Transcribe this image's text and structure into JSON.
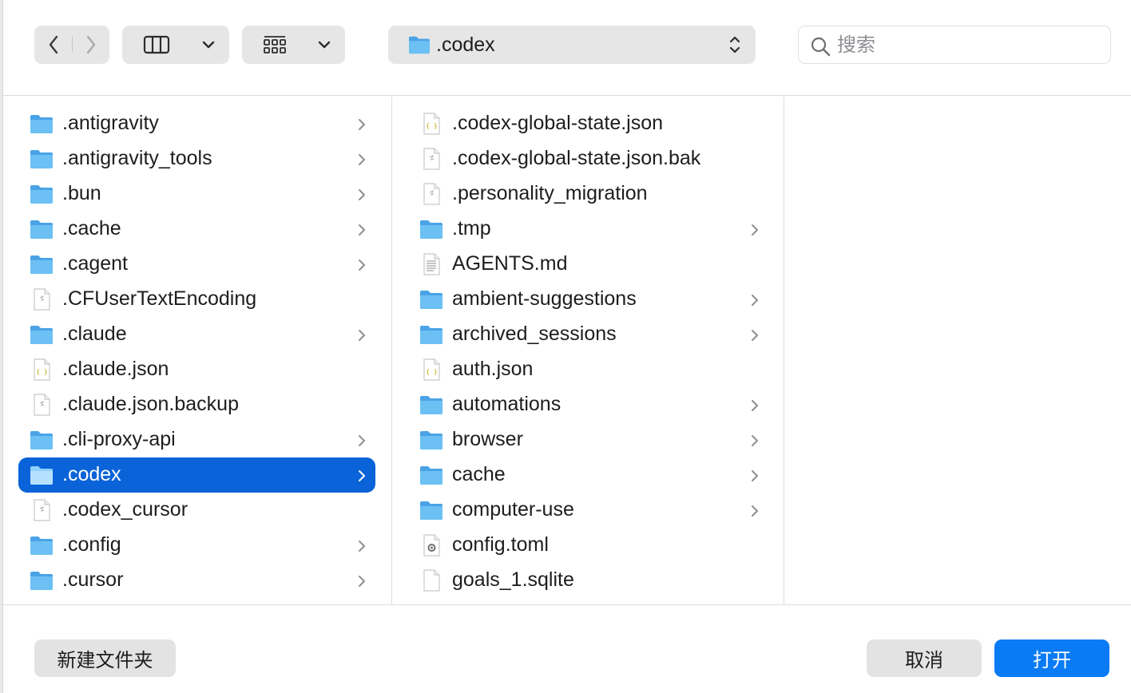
{
  "toolbar": {
    "path_label": ".codex",
    "search_placeholder": "搜索"
  },
  "column1": [
    {
      "label": ".antigravity",
      "kind": "folder",
      "has_children": true
    },
    {
      "label": ".antigravity_tools",
      "kind": "folder",
      "has_children": true
    },
    {
      "label": ".bun",
      "kind": "folder",
      "has_children": true
    },
    {
      "label": ".cache",
      "kind": "folder",
      "has_children": true
    },
    {
      "label": ".cagent",
      "kind": "folder",
      "has_children": true
    },
    {
      "label": ".CFUserTextEncoding",
      "kind": "file-generic",
      "has_children": false
    },
    {
      "label": ".claude",
      "kind": "folder",
      "has_children": true
    },
    {
      "label": ".claude.json",
      "kind": "file-json",
      "has_children": false
    },
    {
      "label": ".claude.json.backup",
      "kind": "file-generic",
      "has_children": false
    },
    {
      "label": ".cli-proxy-api",
      "kind": "folder",
      "has_children": true
    },
    {
      "label": ".codex",
      "kind": "folder",
      "has_children": true,
      "selected": true
    },
    {
      "label": ".codex_cursor",
      "kind": "file-generic",
      "has_children": false
    },
    {
      "label": ".config",
      "kind": "folder",
      "has_children": true
    },
    {
      "label": ".cursor",
      "kind": "folder",
      "has_children": true
    }
  ],
  "column2": [
    {
      "label": ".codex-global-state.json",
      "kind": "file-json",
      "has_children": false
    },
    {
      "label": ".codex-global-state.json.bak",
      "kind": "file-generic",
      "has_children": false
    },
    {
      "label": ".personality_migration",
      "kind": "file-generic",
      "has_children": false
    },
    {
      "label": ".tmp",
      "kind": "folder",
      "has_children": true
    },
    {
      "label": "AGENTS.md",
      "kind": "file-text",
      "has_children": false
    },
    {
      "label": "ambient-suggestions",
      "kind": "folder",
      "has_children": true
    },
    {
      "label": "archived_sessions",
      "kind": "folder",
      "has_children": true
    },
    {
      "label": "auth.json",
      "kind": "file-json",
      "has_children": false
    },
    {
      "label": "automations",
      "kind": "folder",
      "has_children": true
    },
    {
      "label": "browser",
      "kind": "folder",
      "has_children": true
    },
    {
      "label": "cache",
      "kind": "folder",
      "has_children": true
    },
    {
      "label": "computer-use",
      "kind": "folder",
      "has_children": true
    },
    {
      "label": "config.toml",
      "kind": "file-config",
      "has_children": false
    },
    {
      "label": "goals_1.sqlite",
      "kind": "file-blank",
      "has_children": false
    }
  ],
  "buttons": {
    "new_folder": "新建文件夹",
    "cancel": "取消",
    "open": "打开"
  },
  "colors": {
    "selection": "#0a63d8",
    "primary_button": "#0a7bf5",
    "folder": "#58b4ee"
  }
}
